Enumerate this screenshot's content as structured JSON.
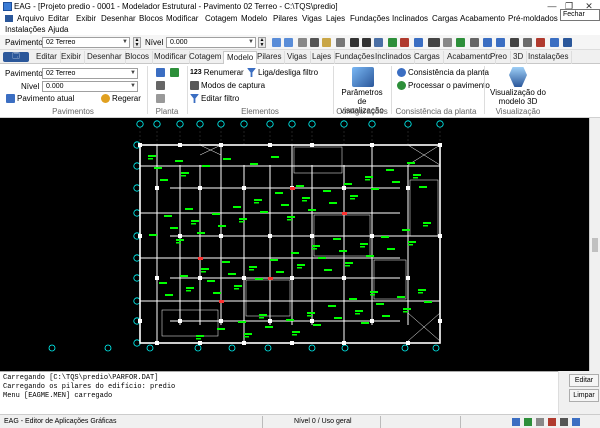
{
  "window": {
    "title": "EAG - [Projeto predio - 0001 - Modelador Estrutural - Pavimento 02 Terreo - C:\\TQS\\predio]",
    "minimize_glyph": "—",
    "restore_glyph": "❐",
    "close_glyph": "✕",
    "tooltip": "Fechar"
  },
  "menubar": {
    "row1": [
      "Arquivo",
      "Editar",
      "Exibir",
      "Desenhar",
      "Blocos",
      "Modificar",
      "Cotagem",
      "Modelo",
      "Pilares",
      "Vigas",
      "Lajes",
      "Fundações",
      "Inclinados",
      "Cargas",
      "Acabamento",
      "Pré-moldados"
    ],
    "row2": [
      "Instalações",
      "Ajuda"
    ]
  },
  "toolbar": {
    "pavimento_label": "Pavimento",
    "pavimento_value": "02 Terreo",
    "nivel_label": "Nível",
    "nivel_value": "0.000"
  },
  "tabs": {
    "file": "🗔",
    "items": [
      "Editar",
      "Exibir",
      "Desenhar",
      "Blocos",
      "Modificar",
      "Cotagem",
      "Modelo",
      "Pilares",
      "Vigas",
      "Lajes",
      "Fundações",
      "Inclinados",
      "Cargas",
      "Acabamento",
      "Preo",
      "3D",
      "Instalações"
    ],
    "active": "Modelo"
  },
  "ribbon": {
    "pav_label": "Pavimento",
    "pav_value": "02 Terreo",
    "nivel_label": "Nível",
    "nivel_value": "0.000",
    "pav_atual": "Pavimento atual",
    "regerar": "Regerar",
    "group_pavimentos": "Pavimentos",
    "group_planta": "Planta",
    "renumerar": "Renumerar",
    "modos_captura": "Modos de captura",
    "editar_filtro": "Editar filtro",
    "liga_filtro": "Liga/desliga filtro",
    "group_elementos": "Elementos",
    "parametros": "Parâmetros de visualização",
    "group_config": "Configurações",
    "consistencia_planta": "Consistência da planta",
    "processar_pav": "Processar o pavimento",
    "group_consist": "Consistência da planta",
    "visualizacao": "Visualização do modelo 3D",
    "group_visual": "Visualização"
  },
  "console": {
    "lines": [
      "Carregando [C:\\TQS\\predio\\PARFOR.DAT]",
      "Carregando os pilares do edifício: predio",
      "Menu [EAGME.MEN] carregado"
    ],
    "edit_button": "Editar",
    "clear_button": "Limpar"
  },
  "statusbar": {
    "app": "EAG - Editor de Aplicações Gráficas",
    "level": "Nível 0 / Uso geral"
  },
  "colors": {
    "canvas_bg": "#000000",
    "drawing": "#ffffff",
    "labels": "#00ff00",
    "highlight": "#ff3030",
    "grid_bubble": "#00ffff"
  }
}
